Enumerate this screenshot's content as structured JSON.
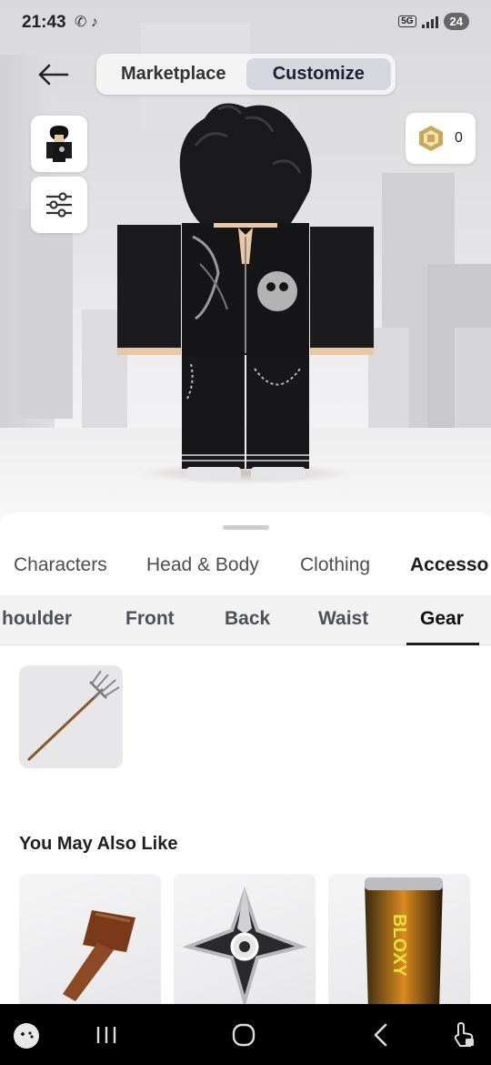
{
  "status_bar": {
    "time": "21:43",
    "network": "5G",
    "battery": "24",
    "app_icons": [
      "whatsapp-icon",
      "tiktok-icon"
    ]
  },
  "header": {
    "tabs": [
      {
        "label": "Marketplace",
        "active": false
      },
      {
        "label": "Customize",
        "active": true
      }
    ]
  },
  "robux": {
    "balance": "0"
  },
  "categories": [
    {
      "label": "Characters",
      "active": false
    },
    {
      "label": "Head & Body",
      "active": false
    },
    {
      "label": "Clothing",
      "active": false
    },
    {
      "label": "Accesso",
      "active": true
    }
  ],
  "subcategories": [
    {
      "label": "houlder",
      "active": false
    },
    {
      "label": "Front",
      "active": false
    },
    {
      "label": "Back",
      "active": false
    },
    {
      "label": "Waist",
      "active": false
    },
    {
      "label": "Gear",
      "active": true
    }
  ],
  "owned_items": [
    {
      "name": "pitchfork-item",
      "icon": "pitchfork-icon"
    }
  ],
  "recommendations": {
    "title": "You May Also Like",
    "items": [
      {
        "icon": "rusty-nail-icon"
      },
      {
        "icon": "shuriken-icon"
      },
      {
        "icon": "bloxy-cola-icon",
        "text": "BLOXY"
      }
    ]
  },
  "colors": {
    "active_segment": "#d6d7de",
    "sheet_bg": "#ffffff",
    "tile_bg": "#e7e7ea",
    "text_dark": "#1c1d24"
  }
}
